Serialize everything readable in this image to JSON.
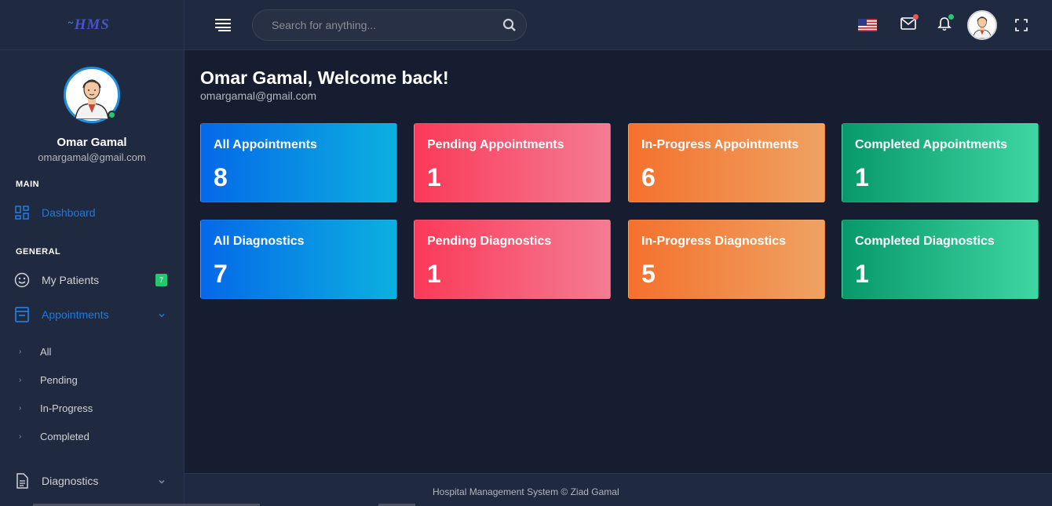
{
  "app": {
    "logo_text": "HMS"
  },
  "sidebar": {
    "user_name": "Omar Gamal",
    "user_email": "omargamal@gmail.com",
    "section_main": "MAIN",
    "section_general": "GENERAL",
    "dashboard_label": "Dashboard",
    "patients_label": "My Patients",
    "patients_badge": "7",
    "appointments_label": "Appointments",
    "appointments_sub": [
      "All",
      "Pending",
      "In-Progress",
      "Completed"
    ],
    "diagnostics_label": "Diagnostics"
  },
  "topbar": {
    "search_placeholder": "Search for anything..."
  },
  "main": {
    "welcome": "Omar Gamal, Welcome back!",
    "email": "omargamal@gmail.com",
    "appointment_cards": [
      {
        "label": "All Appointments",
        "value": "8",
        "color": "#0568e8"
      },
      {
        "label": "Pending Appointments",
        "value": "1",
        "color": "#fa3a58"
      },
      {
        "label": "In-Progress Appointments",
        "value": "6",
        "color": "#f4712d"
      },
      {
        "label": "Completed Appointments",
        "value": "1",
        "color": "#089869"
      }
    ],
    "diagnostic_cards": [
      {
        "label": "All Diagnostics",
        "value": "7",
        "color": "#0568e8"
      },
      {
        "label": "Pending Diagnostics",
        "value": "1",
        "color": "#fa3a58"
      },
      {
        "label": "In-Progress Diagnostics",
        "value": "5",
        "color": "#f4712d"
      },
      {
        "label": "Completed Diagnostics",
        "value": "1",
        "color": "#089869"
      }
    ]
  },
  "footer": {
    "text": "Hospital Management System © Ziad Gamal"
  },
  "colors": {
    "accent": "#1f7ae0",
    "background": "#161d31",
    "panel": "#1f2940",
    "online": "#28c76f",
    "notify_red": "#ea5455"
  }
}
